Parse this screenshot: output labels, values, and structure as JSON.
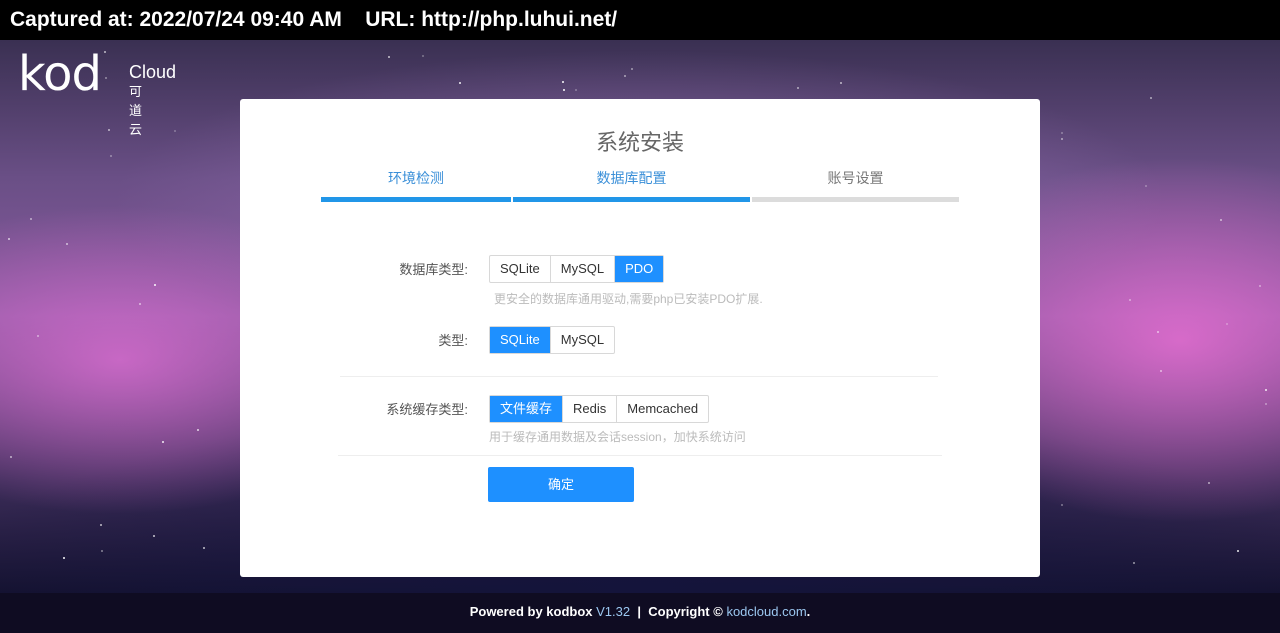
{
  "capture": {
    "text": "Captured at: 2022/07/24 09:40 AM    URL: http://php.luhui.net/"
  },
  "logo": {
    "kod": "kod",
    "cloud": "Cloud",
    "cn": "可道云"
  },
  "installer": {
    "title": "系统安装",
    "steps": [
      {
        "label": "环境检测",
        "state": "done"
      },
      {
        "label": "数据库配置",
        "state": "active"
      },
      {
        "label": "账号设置",
        "state": "pending"
      }
    ],
    "db_type": {
      "label": "数据库类型:",
      "options": [
        "SQLite",
        "MySQL",
        "PDO"
      ],
      "selected": "PDO",
      "hint": "更安全的数据库通用驱动,需要php已安装PDO扩展."
    },
    "pdo_type": {
      "label": "类型:",
      "options": [
        "SQLite",
        "MySQL"
      ],
      "selected": "SQLite"
    },
    "cache_type": {
      "label": "系统缓存类型:",
      "options": [
        "文件缓存",
        "Redis",
        "Memcached"
      ],
      "selected": "文件缓存",
      "hint": "用于缓存通用数据及会话session，加快系统访问"
    },
    "confirm_label": "确定"
  },
  "footer": {
    "powered": "Powered by kodbox",
    "version": "V1.32",
    "sep": "|",
    "copyright": "Copyright ©",
    "link": "kodcloud.com",
    "dot": "."
  },
  "colors": {
    "accent": "#1e90ff",
    "step_active": "#2196e8",
    "step_idle": "#dcdcdc"
  }
}
